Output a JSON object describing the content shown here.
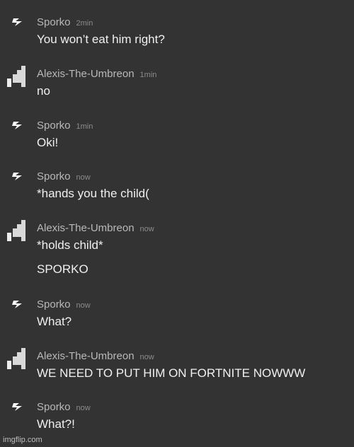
{
  "messages": [
    {
      "author": "Sporko",
      "time": "2min",
      "avatar": "lightning-icon",
      "lines": [
        "You won’t eat him right?"
      ]
    },
    {
      "author": "Alexis-The-Umbreon",
      "time": "1min",
      "avatar": "pixel-stairs-icon",
      "lines": [
        "no"
      ]
    },
    {
      "author": "Sporko",
      "time": "1min",
      "avatar": "lightning-icon",
      "lines": [
        "Oki!"
      ]
    },
    {
      "author": "Sporko",
      "time": "now",
      "avatar": "lightning-icon",
      "lines": [
        "*hands you the child("
      ]
    },
    {
      "author": "Alexis-The-Umbreon",
      "time": "now",
      "avatar": "pixel-stairs-icon",
      "lines": [
        "*holds child*",
        "SPORKO"
      ]
    },
    {
      "author": "Sporko",
      "time": "now",
      "avatar": "lightning-icon",
      "lines": [
        "What?"
      ]
    },
    {
      "author": "Alexis-The-Umbreon",
      "time": "now",
      "avatar": "pixel-stairs-icon",
      "lines": [
        "WE NEED TO PUT HIM ON FORTNITE NOWWW"
      ]
    },
    {
      "author": "Sporko",
      "time": "now",
      "avatar": "lightning-icon",
      "lines": [
        "What?!"
      ]
    }
  ],
  "watermark": "imgflip.com"
}
